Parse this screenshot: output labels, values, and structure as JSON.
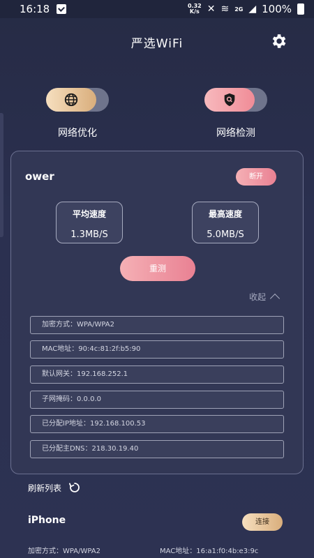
{
  "status_bar": {
    "time": "16:18",
    "net_speed_value": "0.32",
    "net_speed_unit": "K/s",
    "signal_label": "2G",
    "battery": "100%"
  },
  "header": {
    "title": "严选WiFi"
  },
  "features": [
    {
      "label": "网络优化",
      "icon": "globe-icon"
    },
    {
      "label": "网络检测",
      "icon": "shield-search-icon"
    }
  ],
  "current_network": {
    "ssid": "ower",
    "disconnect_label": "断开",
    "avg_speed_label": "平均速度",
    "avg_speed_value": "1.3MB/S",
    "max_speed_label": "最高速度",
    "max_speed_value": "5.0MB/S",
    "retest_label": "重测",
    "collapse_label": "收起",
    "details": [
      "加密方式：WPA/WPA2",
      "MAC地址：90:4c:81:2f:b5:90",
      "默认网关：192.168.252.1",
      "子网掩码：0.0.0.0",
      "已分配IP地址：192.168.100.53",
      "已分配主DNS：218.30.19.40"
    ]
  },
  "refresh_label": "刷新列表",
  "network_list": [
    {
      "name": "iPhone",
      "connect_label": "连接",
      "encryption": "加密方式：WPA/WPA2",
      "mac": "MAC地址：16:a1:f0:4b:e3:9c"
    }
  ],
  "colors": {
    "background": "#2b3050",
    "accent_gold": "#d9ae7c",
    "accent_pink": "#e98193"
  }
}
